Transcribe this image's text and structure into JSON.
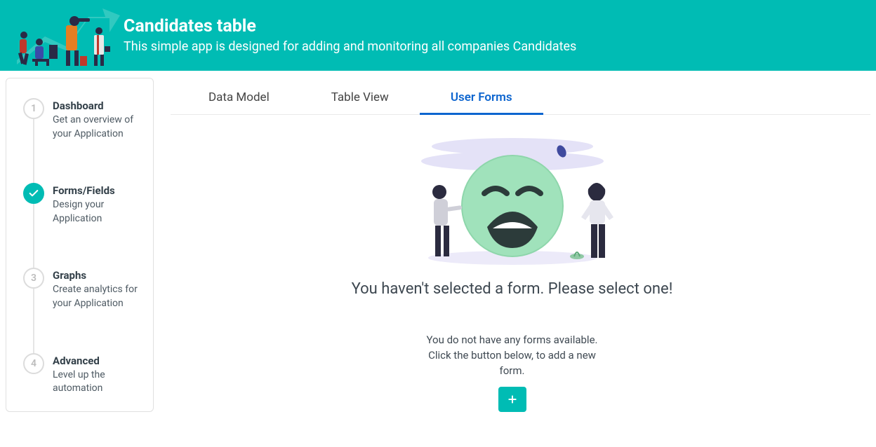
{
  "header": {
    "title": "Candidates table",
    "subtitle": "This simple app is designed for adding and monitoring all companies Candidates"
  },
  "sidebar": {
    "steps": [
      {
        "num": "1",
        "title": "Dashboard",
        "desc": "Get an overview of your Application",
        "active": false
      },
      {
        "num": "2",
        "title": "Forms/Fields",
        "desc": "Design your Application",
        "active": true
      },
      {
        "num": "3",
        "title": "Graphs",
        "desc": "Create analytics for your Application",
        "active": false
      },
      {
        "num": "4",
        "title": "Advanced",
        "desc": "Level up the automation",
        "active": false
      }
    ]
  },
  "tabs": [
    {
      "label": "Data Model",
      "active": false
    },
    {
      "label": "Table View",
      "active": false
    },
    {
      "label": "User Forms",
      "active": true
    }
  ],
  "empty": {
    "headline": "You haven't selected a form. Please select one!",
    "hint": "You do not have any forms available. Click the button below, to add a new form.",
    "add_icon": "plus-icon"
  }
}
